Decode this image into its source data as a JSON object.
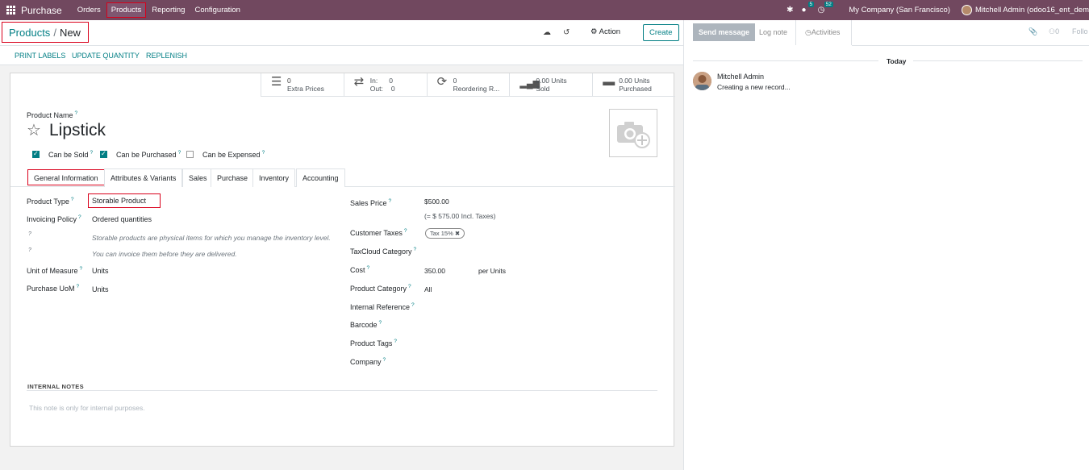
{
  "navbar": {
    "app_name": "Purchase",
    "menu": [
      "Orders",
      "Products",
      "Reporting",
      "Configuration"
    ],
    "active_menu": "Products",
    "messages_count": "5",
    "activities_count": "52",
    "company": "My Company (San Francisco)",
    "user": "Mitchell Admin (odoo16_ent_dem"
  },
  "control": {
    "breadcrumb_parent": "Products",
    "breadcrumb_current": "New",
    "action_label": "Action",
    "create_label": "Create"
  },
  "buttonbar": {
    "print_labels": "PRINT LABELS",
    "update_quantity": "UPDATE QUANTITY",
    "replenish": "REPLENISH"
  },
  "stats": {
    "extra_prices_value": "0",
    "extra_prices_label": "Extra Prices",
    "in_label": "In:",
    "in_value": "0",
    "out_label": "Out:",
    "out_value": "0",
    "reordering_value": "0",
    "reordering_label": "Reordering R...",
    "sold_value": "0.00 Units",
    "sold_label": "Sold",
    "purchased_value": "0.00 Units",
    "purchased_label": "Purchased"
  },
  "product": {
    "name_label": "Product Name",
    "name": "Lipstick",
    "can_be_sold": "Can be Sold",
    "can_be_purchased": "Can be Purchased",
    "can_be_expensed": "Can be Expensed"
  },
  "tabs": [
    "General Information",
    "Attributes & Variants",
    "Sales",
    "Purchase",
    "Inventory",
    "Accounting"
  ],
  "general": {
    "product_type_label": "Product Type",
    "product_type": "Storable Product",
    "invoicing_policy_label": "Invoicing Policy",
    "invoicing_policy": "Ordered quantities",
    "help_1": "Storable products are physical items for which you manage the inventory level.",
    "help_2": "You can invoice them before they are delivered.",
    "uom_label": "Unit of Measure",
    "uom": "Units",
    "purchase_uom_label": "Purchase UoM",
    "purchase_uom": "Units",
    "sales_price_label": "Sales Price",
    "sales_price": "$500.00",
    "incl_taxes": "(= $ 575.00 Incl. Taxes)",
    "customer_taxes_label": "Customer Taxes",
    "customer_tax_tag": "Tax 15%",
    "taxcloud_label": "TaxCloud Category",
    "cost_label": "Cost",
    "cost": "350.00",
    "cost_unit": "per Units",
    "product_category_label": "Product Category",
    "product_category": "All",
    "internal_ref_label": "Internal Reference",
    "barcode_label": "Barcode",
    "product_tags_label": "Product Tags",
    "company_label": "Company"
  },
  "notes": {
    "label": "INTERNAL NOTES",
    "placeholder": "This note is only for internal purposes."
  },
  "chatter": {
    "send_message": "Send message",
    "log_note": "Log note",
    "activities": "Activities",
    "attachments_count": "0",
    "follow": "Follo",
    "today": "Today",
    "author": "Mitchell Admin",
    "message": "Creating a new record..."
  },
  "colors": {
    "navbar": "#71485f",
    "accent": "#017e84",
    "highlight": "#d9001b"
  }
}
